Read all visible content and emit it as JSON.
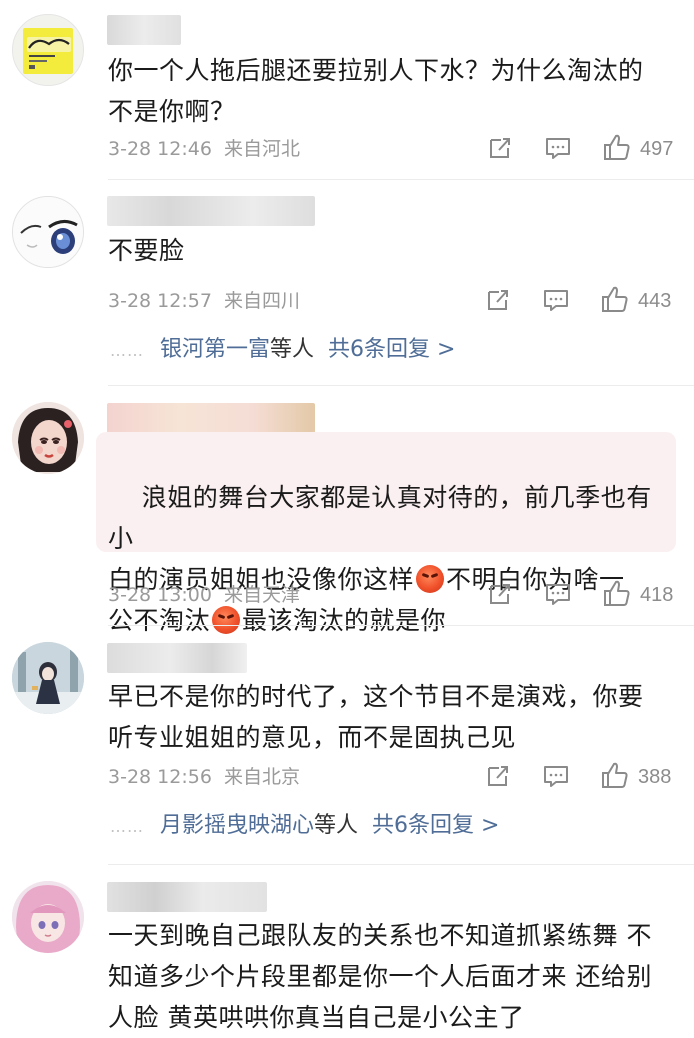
{
  "comments": [
    {
      "text": "你一个人拖后腿还要拉别人下水？为什么淘汰的\n不是你啊？",
      "time": "3-28 12:46",
      "location": "来自河北",
      "likes": "497"
    },
    {
      "text": "不要脸",
      "time": "3-28 12:57",
      "location": "来自四川",
      "likes": "443",
      "replies": {
        "dots": "……",
        "user": "银河第一富",
        "suffix": "等人",
        "total": "共6条回复 >"
      }
    },
    {
      "text_parts": [
        "浪姐的舞台大家都是认真对待的，前几季也有小\n白的演员姐姐也没像你这样",
        "不明白你为啥一\n公不淘汰",
        "最该淘汰的就是你"
      ],
      "emoji": "angry-face-emoji",
      "time": "3-28 13:00",
      "location": "来自天津",
      "likes": "418"
    },
    {
      "text": "早已不是你的时代了，这个节目不是演戏，你要\n听专业姐姐的意见，而不是固执己见",
      "time": "3-28 12:56",
      "location": "来自北京",
      "likes": "388",
      "replies": {
        "dots": "……",
        "user": "月影摇曳映湖心",
        "suffix": "等人",
        "total": "共6条回复 >"
      }
    },
    {
      "text": "一天到晚自己跟队友的关系也不知道抓紧练舞 不\n知道多少个片段里都是你一个人后面才来 还给别\n人脸 黄英哄哄你真当自己是小公主了"
    }
  ],
  "icons": {
    "share": "share-icon",
    "comment": "comment-icon",
    "like": "thumbs-up-icon"
  },
  "colors": {
    "link": "#4f6d96",
    "meta": "#9a9a9a",
    "highlight_bg": "#fbf0f1"
  }
}
